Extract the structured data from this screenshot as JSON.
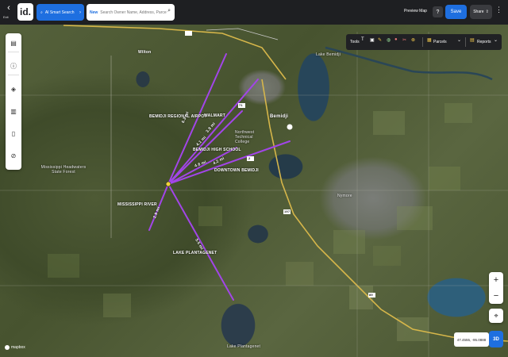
{
  "header": {
    "back_icon": "chevron-left-icon",
    "back_label": "Exit",
    "logo_text": "id.",
    "ai_search_label": "AI Smart Search",
    "search_tag": "New",
    "search_placeholder": "Search Owner Name, Address, Parcel Id",
    "preview_label": "Preview Map",
    "help_label": "?",
    "save_label": "Save",
    "share_label": "Share"
  },
  "toolbar": {
    "tools_label": "Tools",
    "parcels_label": "Parcels",
    "reports_label": "Reports"
  },
  "map": {
    "labels": {
      "wilton": "Wilton",
      "bemidji": "Bemidji",
      "airport": "BEMIDJI REGIONAL AIRPOT",
      "walmart": "WALMART",
      "high_school": "BEMIDJI HIGH SCHOOL",
      "downtown": "DOWNTOWN BEMIDJI",
      "mississippi": "MISSISSIPPI RIVER",
      "lake_plantagenet": "LAKE PLANTAGENET",
      "lake_plantagenet_water": "Lake Plantagenet",
      "mississippi_headwaters": "Mississippi Headwaters State Forest",
      "lake_bemidji": "Lake Bemidji",
      "nymore": "Nymore",
      "sugar_hills": "Northwest Technical College",
      "hwy_71": "71",
      "hwy_2": "2",
      "hwy_197": "197",
      "hwy_89": "89"
    },
    "route_labels": {
      "r_airport": "3.8 mi",
      "r_walmart": "4.1 mi",
      "r_hs": "4.2 mi",
      "r_downtown": "4.6 mi",
      "r_wilton": "6.3 mi",
      "r_river": "2.9 mi",
      "r_lake": "5.5 mi"
    },
    "coordinates": "47.4555, -95.0888",
    "attribution": "mapbox",
    "route_color": "#a245e8"
  },
  "controls": {
    "zoom_in": "+",
    "zoom_out": "−",
    "btn_3d": "3D"
  }
}
